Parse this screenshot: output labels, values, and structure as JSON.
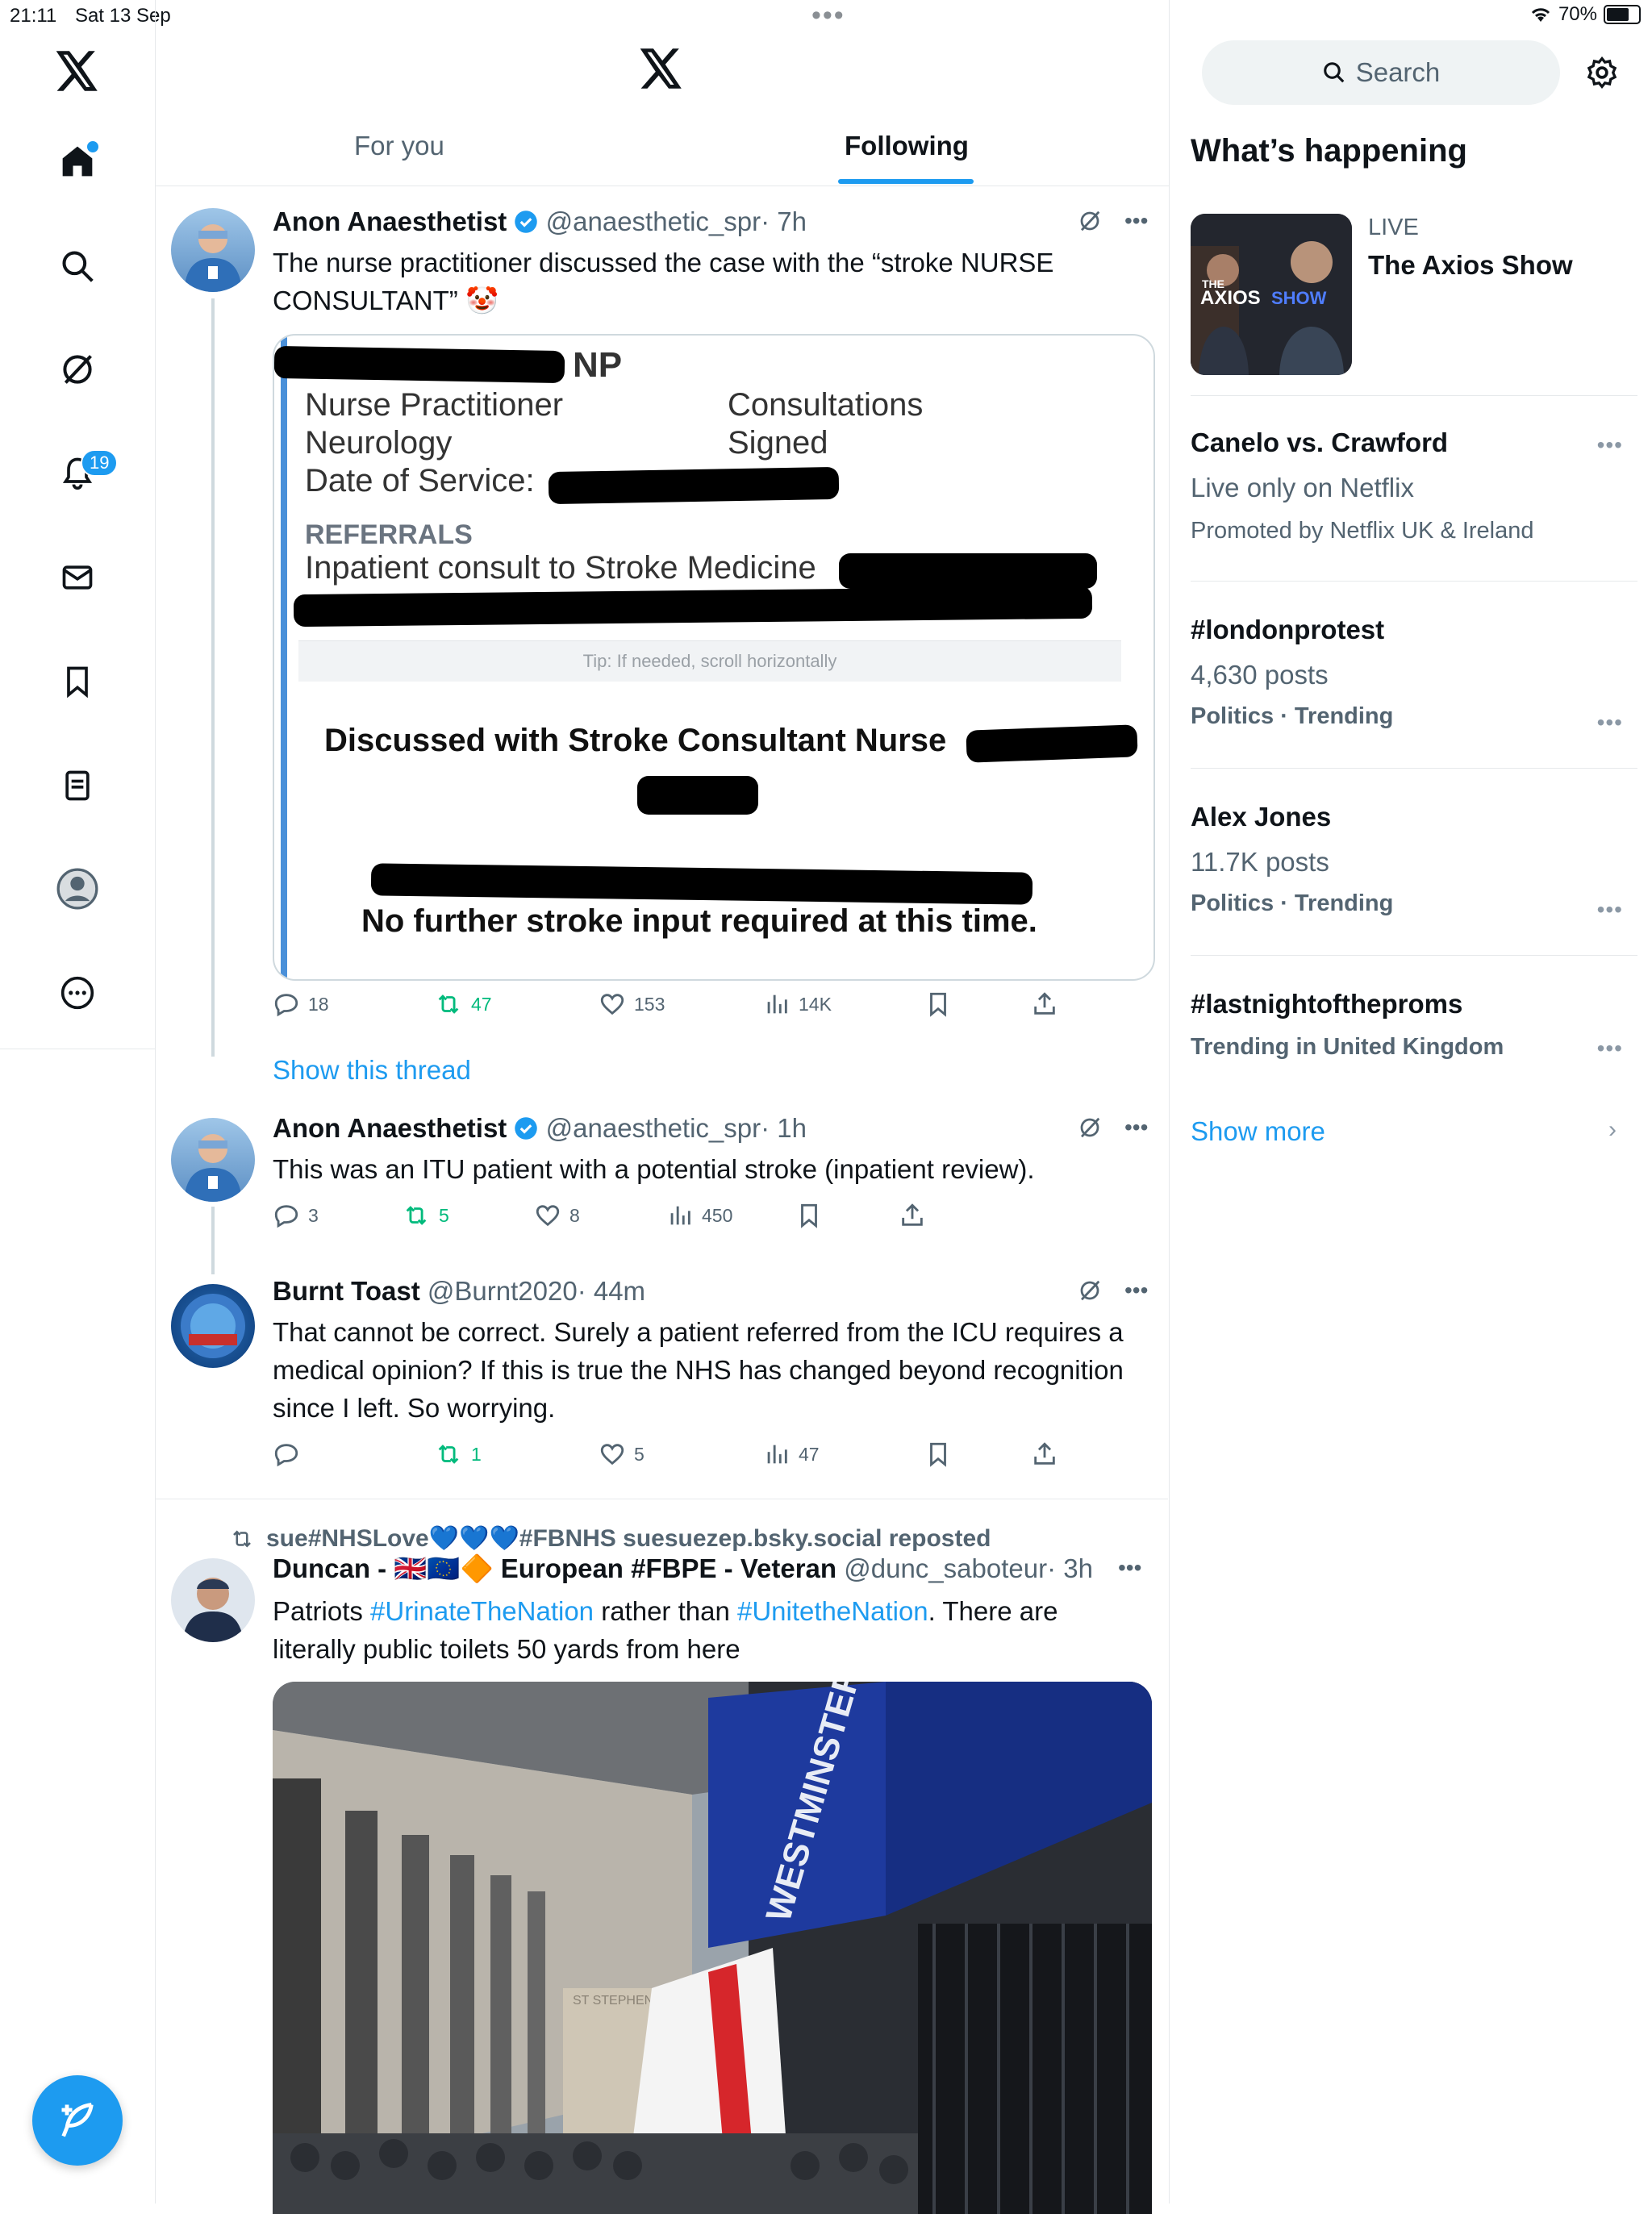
{
  "status": {
    "time": "21:11",
    "date": "Sat 13 Sep",
    "battery": "70%",
    "battery_level": 0.7
  },
  "nav": {
    "notifications_badge": "19"
  },
  "tabs": {
    "for_you": "For you",
    "following": "Following"
  },
  "tweets": [
    {
      "name": "Anon Anaesthetist",
      "handle": "@anaesthetic_spr",
      "time": "· 7h",
      "text": "The nurse practitioner discussed the case with the “stroke NURSE CONSULTANT” 🤡",
      "image": {
        "title_suffix": "NP",
        "line1_left": "Nurse Practitioner",
        "line1_right": "Consultations",
        "line2_left": "Neurology",
        "line2_right": "Signed",
        "line3": "Date of Service:",
        "section": "REFERRALS",
        "referral": "Inpatient consult to Stroke Medicine",
        "tip": "Tip: If needed, scroll horizontally",
        "discussed": "Discussed with Stroke Consultant Nurse",
        "conclusion": "No further stroke input required at this time."
      },
      "replies": "18",
      "reposts": "47",
      "likes": "153",
      "views": "14K",
      "show_thread": "Show this thread"
    },
    {
      "name": "Anon Anaesthetist",
      "handle": "@anaesthetic_spr",
      "time": "· 1h",
      "text": "This was an ITU patient with a potential stroke (inpatient review).",
      "replies": "3",
      "reposts": "5",
      "likes": "8",
      "views": "450"
    },
    {
      "name": "Burnt Toast",
      "handle": "@Burnt2020",
      "time": "· 44m",
      "text": "That cannot be correct. Surely a patient referred from the ICU requires a medical opinion? If this is true the NHS has changed beyond recognition since I left. So worrying.",
      "replies": "",
      "reposts": "1",
      "likes": "5",
      "views": "47"
    },
    {
      "repost_label": "sue#NHSLove💙💙💙#FBNHS suesuezep.bsky.social reposted",
      "name_prefix": "Duncan - 🇬🇧🇪🇺🔶 European #FBPE - Veteran",
      "handle": "@dunc_saboteur",
      "time": "· 3h",
      "text_a": "Patriots ",
      "hashtag1": "#UrinateTheNation",
      "text_b": " rather than ",
      "hashtag2": "#UnitetheNation",
      "text_c": ". There are literally public toilets 50 yards from here",
      "photo_sign": "WESTMINSTER STATION",
      "photo_street": "ST STEPHEN"
    }
  ],
  "right": {
    "search_placeholder": "Search",
    "title": "What’s happening",
    "live": {
      "label": "LIVE",
      "title": "The Axios Show",
      "thumb_text1": "THE",
      "thumb_text2": "AXIOS",
      "thumb_text3": "SHOW"
    },
    "trends": [
      {
        "title": "Canelo vs. Crawford",
        "line2": "Live only on Netflix",
        "line3": "Promoted by Netflix UK & Ireland"
      },
      {
        "title": "#londonprotest",
        "line2": "4,630 posts",
        "line3": "Politics · Trending"
      },
      {
        "title": "Alex Jones",
        "line2": "11.7K posts",
        "line3": "Politics · Trending"
      },
      {
        "title": "#lastnightoftheproms",
        "line2": "Trending in United Kingdom"
      }
    ],
    "show_more": "Show more"
  },
  "colors": {
    "accent": "#1d9bf0",
    "repost": "#00ba7c",
    "secondary": "#536471"
  }
}
